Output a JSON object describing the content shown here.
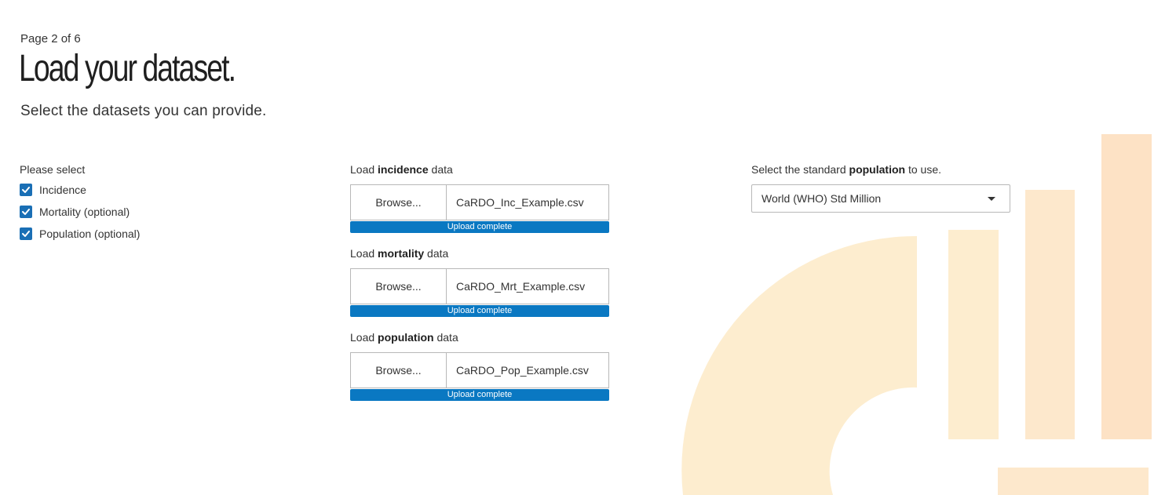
{
  "header": {
    "page_counter": "Page 2 of 6",
    "title": "Load your dataset.",
    "subtitle": "Select the datasets you can provide."
  },
  "datasets": {
    "label": "Please select",
    "options": [
      {
        "label": "Incidence",
        "checked": true
      },
      {
        "label": "Mortality (optional)",
        "checked": true
      },
      {
        "label": "Population (optional)",
        "checked": true
      }
    ]
  },
  "uploads": [
    {
      "label_prefix": "Load ",
      "label_bold": "incidence",
      "label_suffix": " data",
      "browse_label": "Browse...",
      "file_name": "CaRDO_Inc_Example.csv",
      "status": "Upload complete",
      "progress": 1.0
    },
    {
      "label_prefix": "Load ",
      "label_bold": "mortality",
      "label_suffix": " data",
      "browse_label": "Browse...",
      "file_name": "CaRDO_Mrt_Example.csv",
      "status": "Upload complete",
      "progress": 1.0
    },
    {
      "label_prefix": "Load ",
      "label_bold": "population",
      "label_suffix": " data",
      "browse_label": "Browse...",
      "file_name": "CaRDO_Pop_Example.csv",
      "status": "Upload complete",
      "progress": 1.0
    }
  ],
  "population_select": {
    "label_prefix": "Select the standard ",
    "label_bold": "population",
    "label_suffix": " to use.",
    "selected": "World (WHO) Std Million"
  },
  "colors": {
    "accent": "#0a78c2",
    "checkbox": "#1a6fb5",
    "decor_light": "#fdedcf",
    "decor_peach": "#fde2c5"
  },
  "icons": {
    "checkbox": "check-icon",
    "dropdown": "caret-down-icon",
    "decoration": "chart-logo-decoration"
  }
}
